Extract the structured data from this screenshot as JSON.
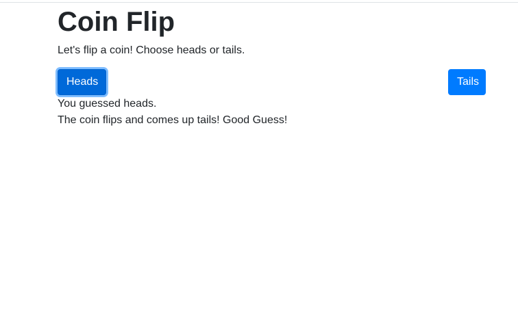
{
  "header": {
    "title": "Coin Flip",
    "intro": "Let's flip a coin! Choose heads or tails."
  },
  "buttons": {
    "heads_label": "Heads",
    "tails_label": "Tails"
  },
  "result": {
    "guess_text": "You guessed heads.",
    "outcome_text": "The coin flips and comes up tails! Good Guess!"
  },
  "colors": {
    "primary": "#007bff",
    "primary_active": "#0069d9",
    "text": "#212529"
  }
}
